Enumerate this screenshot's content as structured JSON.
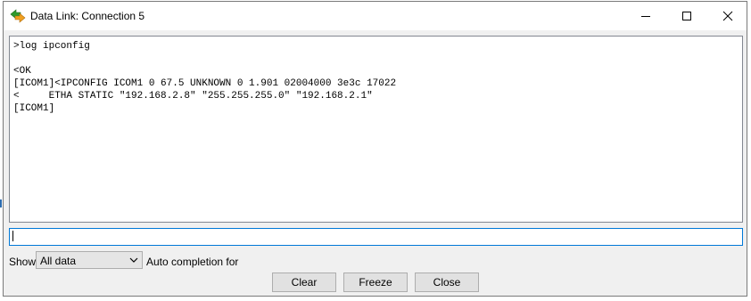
{
  "window": {
    "title": "Data Link: Connection 5",
    "icon": "data-link-arrows-icon",
    "controls": [
      "minimize-icon",
      "maximize-icon",
      "close-icon"
    ]
  },
  "console": {
    "lines": [
      ">log ipconfig",
      "",
      "<OK",
      "[ICOM1]<IPCONFIG ICOM1 0 67.5 UNKNOWN 0 1.901 02004000 3e3c 17022",
      "<     ETHA STATIC \"192.168.2.8\" \"255.255.255.0\" \"192.168.2.1\"",
      "[ICOM1]"
    ]
  },
  "command_input": {
    "value": ""
  },
  "controls": {
    "show_label": "Show",
    "show_selected": "All data",
    "autocompletion_label": "Auto completion for"
  },
  "buttons": {
    "clear": "Clear",
    "freeze": "Freeze",
    "close": "Close"
  },
  "colors": {
    "accent": "#0078d7",
    "window_bg": "#f0f0f0",
    "icon_green": "#2e9a2e",
    "icon_orange": "#f0a020"
  }
}
